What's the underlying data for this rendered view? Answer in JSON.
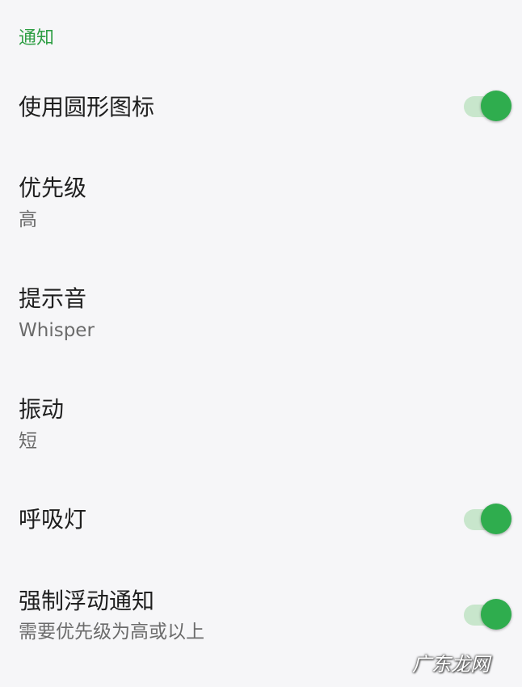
{
  "section": {
    "header": "通知"
  },
  "settings": [
    {
      "title": "使用圆形图标",
      "subtitle": "",
      "toggle": true
    },
    {
      "title": "优先级",
      "subtitle": "高",
      "toggle": false
    },
    {
      "title": "提示音",
      "subtitle": "Whisper",
      "toggle": false
    },
    {
      "title": "振动",
      "subtitle": "短",
      "toggle": false
    },
    {
      "title": "呼吸灯",
      "subtitle": "",
      "toggle": true
    },
    {
      "title": "强制浮动通知",
      "subtitle": "需要优先级为高或以上",
      "toggle": true
    }
  ],
  "toggle_states": {
    "round_icon": "on",
    "breathing_light": "on",
    "force_floating": "on"
  },
  "colors": {
    "accent": "#2fad4e",
    "track_on": "#c8e6cc",
    "background": "#f6f6f8"
  },
  "watermark": "广东龙网"
}
